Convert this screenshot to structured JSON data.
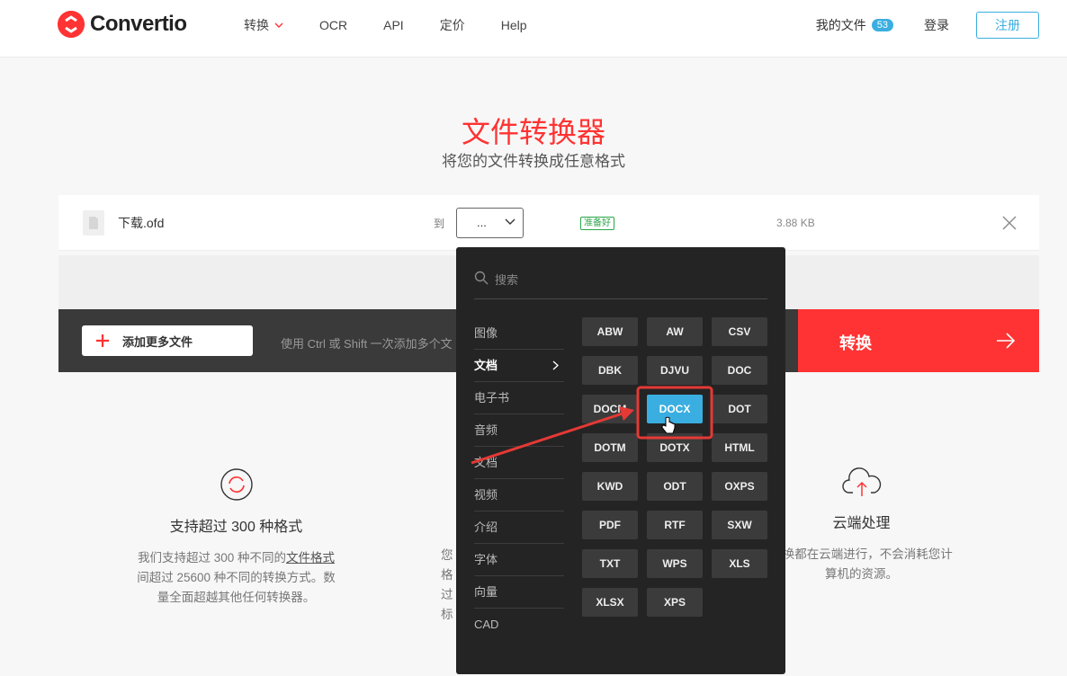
{
  "header": {
    "logo_text": "Convertio",
    "nav": [
      "转换",
      "OCR",
      "API",
      "定价",
      "Help"
    ],
    "my_files": "我的文件",
    "my_files_count": "53",
    "login": "登录",
    "signup": "注册"
  },
  "hero": {
    "title": "文件转换器",
    "subtitle": "将您的文件转换成任意格式"
  },
  "file": {
    "name": "下载.ofd",
    "to_label": "到",
    "format_value": "...",
    "status": "准备好",
    "size": "3.88 KB"
  },
  "actions": {
    "add_more": "添加更多文件",
    "hint": "使用 Ctrl 或 Shift 一次添加多个文",
    "convert": "转换"
  },
  "features": [
    {
      "title": "支持超过 300 种格式",
      "line1_pre": "我们支持超过 300 种不同的",
      "line1_link": "文件格式",
      "line2": "间超过 25600 种不同的转换方式。数",
      "line3": "量全面超越其他任何转换器。"
    },
    {
      "frag1": "您",
      "frag2": "格",
      "frag3": "过",
      "frag4": "标"
    },
    {
      "title": "云端处理",
      "line1": "转换都在云端进行，不会消耗您计",
      "line2": "算机的资源。"
    }
  ],
  "dropdown": {
    "search_placeholder": "搜索",
    "categories": [
      "图像",
      "文档",
      "电子书",
      "音频",
      "文档",
      "视频",
      "介绍",
      "字体",
      "向量",
      "CAD"
    ],
    "active_category": "文档",
    "formats": [
      "ABW",
      "AW",
      "CSV",
      "DBK",
      "DJVU",
      "DOC",
      "DOCM",
      "DOCX",
      "DOT",
      "DOTM",
      "DOTX",
      "HTML",
      "KWD",
      "ODT",
      "OXPS",
      "PDF",
      "RTF",
      "SXW",
      "TXT",
      "WPS",
      "XLS",
      "XLSX",
      "XPS"
    ],
    "selected_format": "DOCX"
  },
  "colors": {
    "brand_red": "#ff3333",
    "accent_blue": "#3aaee0",
    "dropdown_bg": "#242424",
    "ready_green": "#2ba74a"
  }
}
